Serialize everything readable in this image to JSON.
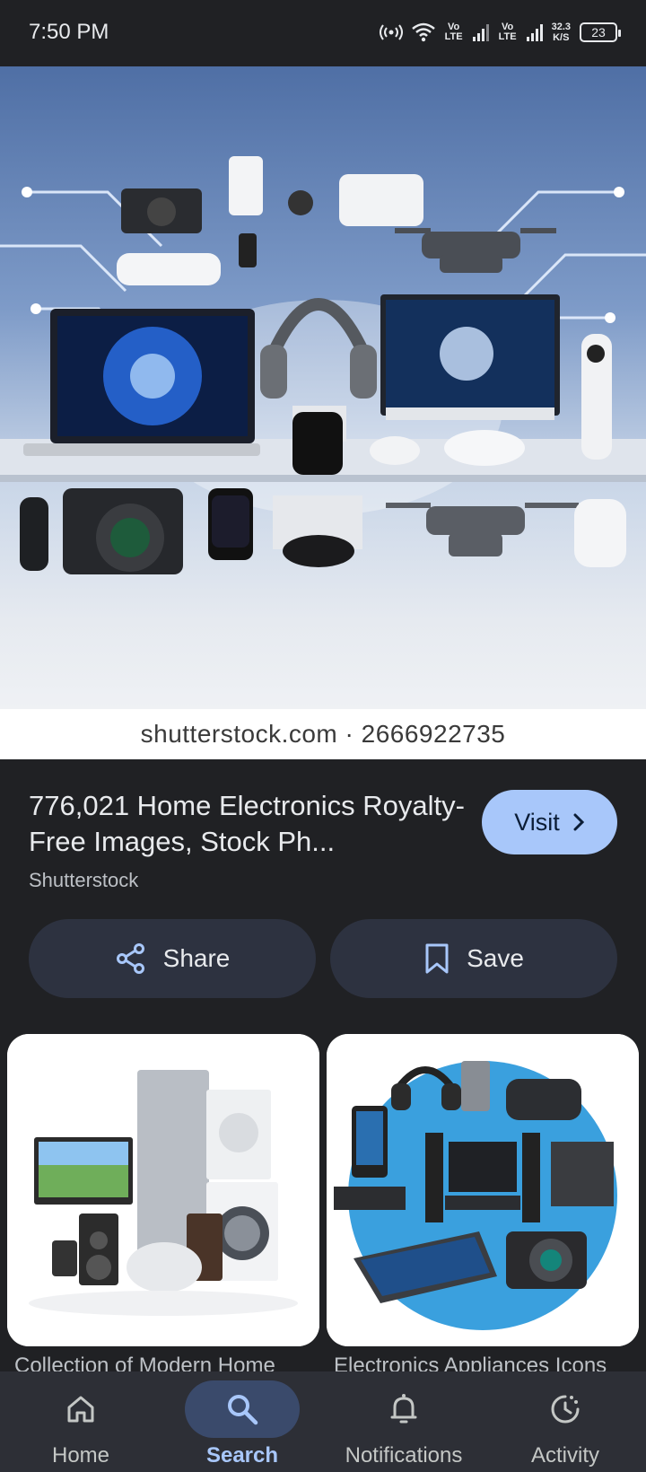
{
  "status_bar": {
    "time": "7:50 PM",
    "network_speed_value": "32.3",
    "network_speed_unit": "K/S",
    "battery": "23",
    "volte_1": "Vo LTE",
    "volte_2": "Vo LTE"
  },
  "hero_image": {
    "watermark": "shutterstock.com · 2666922735"
  },
  "result": {
    "title": "776,021 Home Electronics Royalty-Free Images, Stock Ph...",
    "source": "Shutterstock",
    "visit_label": "Visit"
  },
  "actions": {
    "share_label": "Share",
    "save_label": "Save"
  },
  "related": [
    {
      "caption": "Collection of Modern Home"
    },
    {
      "caption": "Electronics Appliances Icons"
    }
  ],
  "bottom_nav": {
    "items": [
      {
        "label": "Home",
        "icon": "home-icon",
        "active": false
      },
      {
        "label": "Search",
        "icon": "search-icon",
        "active": true
      },
      {
        "label": "Notifications",
        "icon": "bell-icon",
        "active": false
      },
      {
        "label": "Activity",
        "icon": "activity-icon",
        "active": false
      }
    ]
  },
  "colors": {
    "background": "#202124",
    "accent": "#a8c7fa",
    "button_bg": "#2d3240",
    "nav_bg": "#2d2f36"
  }
}
